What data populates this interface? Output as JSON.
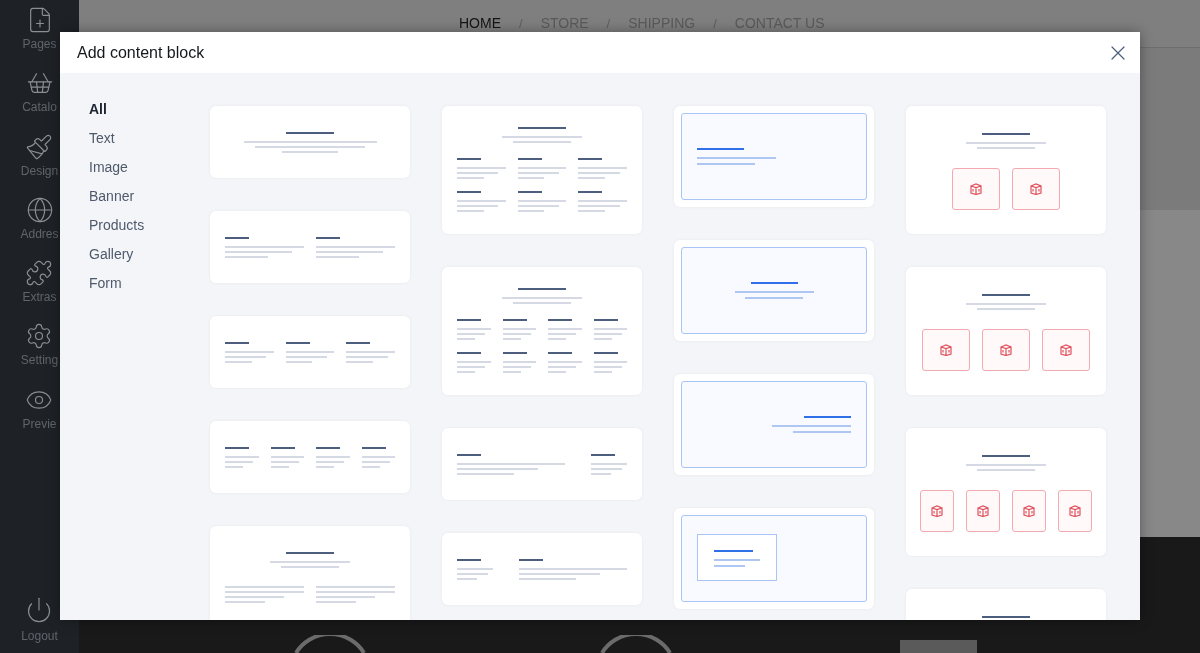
{
  "sidebar": {
    "items": [
      {
        "label": "Pages"
      },
      {
        "label": "Catalo"
      },
      {
        "label": "Design"
      },
      {
        "label": "Addres"
      },
      {
        "label": "Extras"
      },
      {
        "label": "Setting"
      },
      {
        "label": "Previe"
      }
    ],
    "logout": {
      "label": "Logout"
    }
  },
  "top_nav": {
    "items": [
      {
        "label": "HOME",
        "selected": true
      },
      {
        "label": "STORE",
        "selected": false
      },
      {
        "label": "SHIPPING",
        "selected": false
      },
      {
        "label": "CONTACT US",
        "selected": false
      }
    ],
    "separator": "/"
  },
  "dialog": {
    "title": "Add content block",
    "categories": [
      {
        "label": "All",
        "selected": true
      },
      {
        "label": "Text",
        "selected": false
      },
      {
        "label": "Image",
        "selected": false
      },
      {
        "label": "Banner",
        "selected": false
      },
      {
        "label": "Products",
        "selected": false
      },
      {
        "label": "Gallery",
        "selected": false
      },
      {
        "label": "Form",
        "selected": false
      }
    ],
    "block_columns": [
      [
        {
          "kind": "heading"
        },
        {
          "kind": "columns-2"
        },
        {
          "kind": "columns-3"
        },
        {
          "kind": "columns-4"
        },
        {
          "kind": "heading-columns-2"
        }
      ],
      [
        {
          "kind": "heading-grid-3"
        },
        {
          "kind": "heading-grid-4"
        },
        {
          "kind": "text-aside"
        },
        {
          "kind": "aside-text"
        }
      ],
      [
        {
          "kind": "banner-left"
        },
        {
          "kind": "banner-center"
        },
        {
          "kind": "banner-right"
        },
        {
          "kind": "banner-boxed"
        }
      ],
      [
        {
          "kind": "products-2"
        },
        {
          "kind": "products-3"
        },
        {
          "kind": "products-4"
        },
        {
          "kind": "heading-top"
        }
      ]
    ]
  }
}
